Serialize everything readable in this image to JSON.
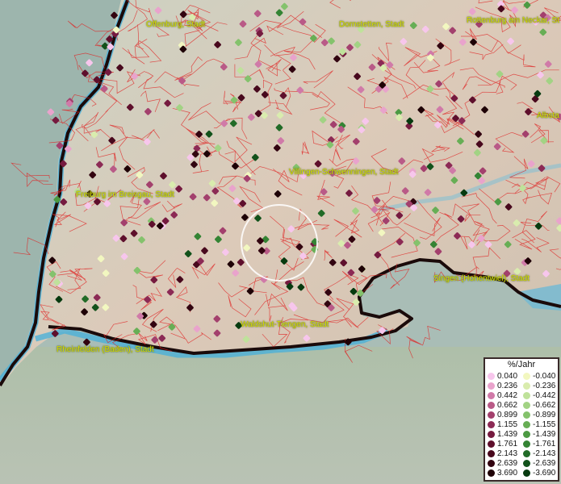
{
  "map": {
    "places": [
      {
        "name": "Offenburg, Stadt"
      },
      {
        "name": "Dornstetten, Stadt"
      },
      {
        "name": "Rottenburg am Neckar, St"
      },
      {
        "name": "Albsta"
      },
      {
        "name": "Villingen-Schwenningen, Stadt"
      },
      {
        "name": "Freiburg im Breisgau, Stadt"
      },
      {
        "name": "Singen (Hohentwiel), Stadt"
      },
      {
        "name": "Waldshut-Tiengen, Stadt"
      },
      {
        "name": "Rheinfelden (Baden), Stadt"
      }
    ],
    "colors": {
      "water": "#8fb3b3",
      "river": "#4bb0d8",
      "land": "#d9c9b8",
      "boundary": "#e02020",
      "border": "#1a0a0a",
      "label": "#d8e000"
    }
  },
  "legend": {
    "title": "%/Jahr",
    "positive": [
      {
        "value": "0.040",
        "color": "#f7c6ec"
      },
      {
        "value": "0.236",
        "color": "#e9a3cc"
      },
      {
        "value": "0.442",
        "color": "#d07aa8"
      },
      {
        "value": "0.662",
        "color": "#b95a87"
      },
      {
        "value": "0.899",
        "color": "#a3406d"
      },
      {
        "value": "1.155",
        "color": "#8c2a55"
      },
      {
        "value": "1.439",
        "color": "#751a3f"
      },
      {
        "value": "1.761",
        "color": "#5e0f2c"
      },
      {
        "value": "2.143",
        "color": "#48081d"
      },
      {
        "value": "2.639",
        "color": "#320410"
      },
      {
        "value": "3.690",
        "color": "#1e0106"
      }
    ],
    "negative": [
      {
        "value": "-0.040",
        "color": "#f2f7c0"
      },
      {
        "value": "-0.236",
        "color": "#d9ecae"
      },
      {
        "value": "-0.442",
        "color": "#bfe29b"
      },
      {
        "value": "-0.662",
        "color": "#a2d384"
      },
      {
        "value": "-0.899",
        "color": "#84c26c"
      },
      {
        "value": "-1.155",
        "color": "#67ae55"
      },
      {
        "value": "-1.439",
        "color": "#4c9a43"
      },
      {
        "value": "-1.761",
        "color": "#348434"
      },
      {
        "value": "-2.143",
        "color": "#216b27"
      },
      {
        "value": "-2.639",
        "color": "#12521b"
      },
      {
        "value": "-3.690",
        "color": "#063a0f"
      }
    ]
  }
}
